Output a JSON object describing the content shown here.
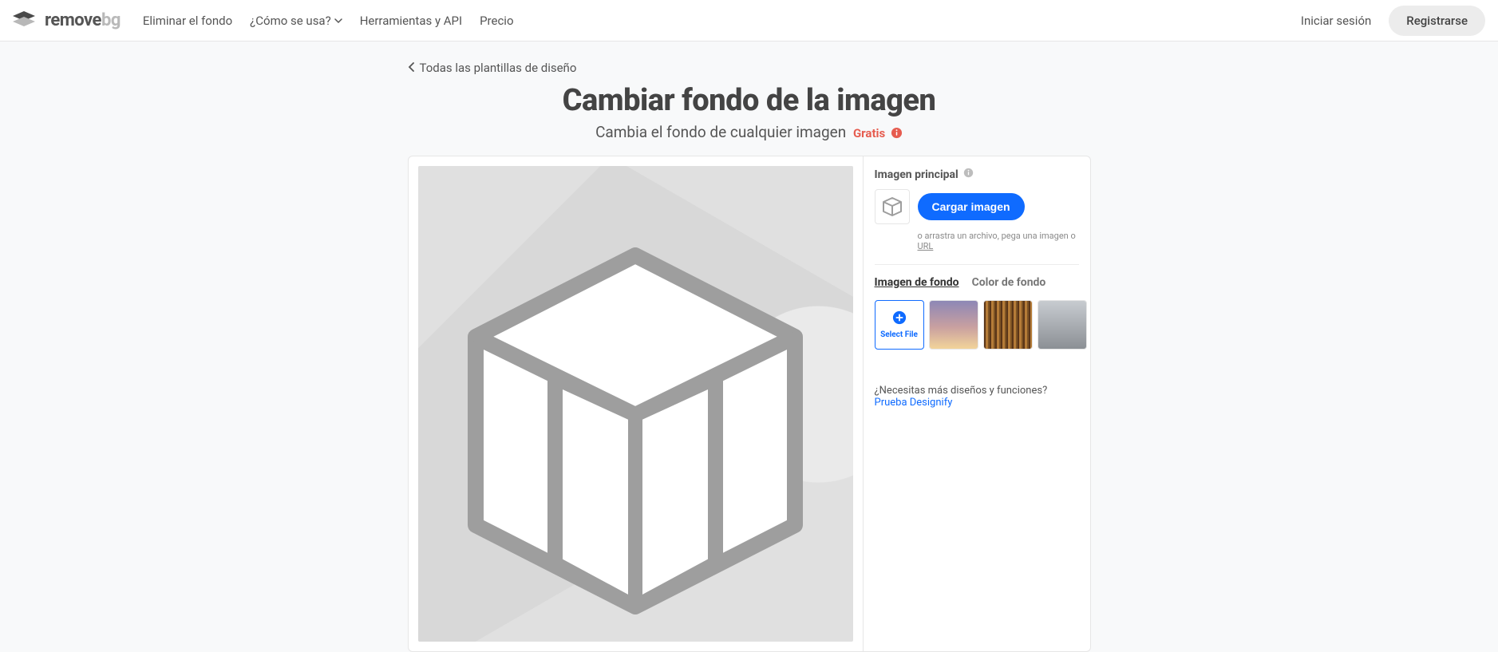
{
  "header": {
    "logo": {
      "name1": "remove",
      "name2": "bg"
    },
    "nav": {
      "remove_bg": "Eliminar el fondo",
      "how": "¿Cómo se usa?",
      "tools": "Herramientas y API",
      "pricing": "Precio"
    },
    "login": "Iniciar sesión",
    "signup": "Registrarse"
  },
  "back_link": "Todas las plantillas de diseño",
  "title": "Cambiar fondo de la imagen",
  "subtitle": "Cambia el fondo de cualquier imagen",
  "subtitle_free": "Gratis",
  "side": {
    "main_image_label": "Imagen principal",
    "upload_btn": "Cargar imagen",
    "drag_hint_pre": "o arrastra un archivo, pega una imagen o ",
    "drag_hint_url": "URL",
    "tab_bg_image": "Imagen de fondo",
    "tab_bg_color": "Color de fondo",
    "select_file": "Select File",
    "cta_text": "¿Necesitas más diseños y funciones? ",
    "cta_link": "Prueba Designify"
  }
}
